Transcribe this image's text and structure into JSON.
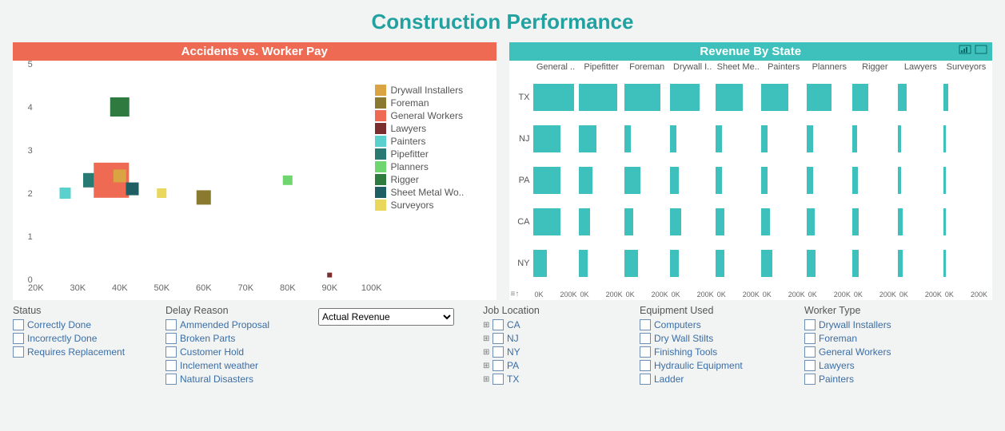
{
  "title": "Construction Performance",
  "colors": {
    "accent_red": "#ef6a53",
    "accent_teal": "#3ec1bd"
  },
  "left_panel": {
    "header": "Accidents vs. Worker Pay",
    "legend": [
      {
        "name": "Drywall Installers",
        "color": "#d9a441"
      },
      {
        "name": "Foreman",
        "color": "#8a7a2f"
      },
      {
        "name": "General Workers",
        "color": "#ef6a53"
      },
      {
        "name": "Lawyers",
        "color": "#7a2e2e"
      },
      {
        "name": "Painters",
        "color": "#5bd1cd"
      },
      {
        "name": "Pipefitter",
        "color": "#2a7a74"
      },
      {
        "name": "Planners",
        "color": "#6fd66f"
      },
      {
        "name": "Rigger",
        "color": "#2e7a3f"
      },
      {
        "name": "Sheet Metal Wo..",
        "color": "#1f5f63"
      },
      {
        "name": "Surveyors",
        "color": "#e9d85c"
      }
    ]
  },
  "right_panel": {
    "header": "Revenue By State",
    "columns": [
      "General ..",
      "Pipefitter",
      "Foreman",
      "Drywall I..",
      "Sheet Me..",
      "Painters",
      "Planners",
      "Rigger",
      "Lawyers",
      "Surveyors"
    ],
    "rows": [
      "TX",
      "NJ",
      "PA",
      "CA",
      "NY"
    ],
    "x_tick_pair": [
      "0K",
      "200K"
    ]
  },
  "filters": {
    "status": {
      "label": "Status",
      "items": [
        "Correctly Done",
        "Incorrectly Done",
        "Requires Replacement"
      ]
    },
    "delay": {
      "label": "Delay Reason",
      "items": [
        "Ammended Proposal",
        "Broken Parts",
        "Customer Hold",
        "Inclement weather",
        "Natural Disasters"
      ]
    },
    "combo_value": "Actual Revenue",
    "job_loc": {
      "label": "Job Location",
      "items": [
        "CA",
        "NJ",
        "NY",
        "PA",
        "TX"
      ]
    },
    "equip": {
      "label": "Equipment Used",
      "items": [
        "Computers",
        "Dry Wall Stilts",
        "Finishing Tools",
        "Hydraulic Equipment",
        "Ladder"
      ]
    },
    "worker": {
      "label": "Worker Type",
      "items": [
        "Drywall Installers",
        "Foreman",
        "General Workers",
        "Lawyers",
        "Painters"
      ]
    }
  },
  "chart_data": [
    {
      "type": "scatter",
      "title": "Accidents vs. Worker Pay",
      "xlabel": "",
      "ylabel": "",
      "xlim": [
        20000,
        100000
      ],
      "ylim": [
        0,
        5
      ],
      "x_ticks": [
        "20K",
        "30K",
        "40K",
        "50K",
        "60K",
        "70K",
        "80K",
        "90K",
        "100K"
      ],
      "y_ticks": [
        0,
        1,
        2,
        3,
        4,
        5
      ],
      "series": [
        {
          "name": "Painters",
          "x": 27000,
          "y": 2.0,
          "size": 14,
          "color": "#5bd1cd"
        },
        {
          "name": "Pipefitter",
          "x": 33000,
          "y": 2.3,
          "size": 18,
          "color": "#2a7a74"
        },
        {
          "name": "General Workers",
          "x": 38000,
          "y": 2.3,
          "size": 44,
          "color": "#ef6a53"
        },
        {
          "name": "Drywall Installers",
          "x": 40000,
          "y": 2.4,
          "size": 16,
          "color": "#d9a441"
        },
        {
          "name": "Sheet Metal Wo..",
          "x": 43000,
          "y": 2.1,
          "size": 16,
          "color": "#1f5f63"
        },
        {
          "name": "Rigger",
          "x": 40000,
          "y": 4.0,
          "size": 24,
          "color": "#2e7a3f"
        },
        {
          "name": "Surveyors",
          "x": 50000,
          "y": 2.0,
          "size": 12,
          "color": "#e9d85c"
        },
        {
          "name": "Foreman",
          "x": 60000,
          "y": 1.9,
          "size": 18,
          "color": "#8a7a2f"
        },
        {
          "name": "Planners",
          "x": 80000,
          "y": 2.3,
          "size": 12,
          "color": "#6fd66f"
        },
        {
          "name": "Lawyers",
          "x": 90000,
          "y": 0.1,
          "size": 6,
          "color": "#7a2e2e"
        }
      ]
    },
    {
      "type": "bar",
      "title": "Revenue By State",
      "orientation": "horizontal_small_multiples",
      "xlim": [
        0,
        200000
      ],
      "columns": [
        "General ..",
        "Pipefitter",
        "Foreman",
        "Drywall I..",
        "Sheet Me..",
        "Painters",
        "Planners",
        "Rigger",
        "Lawyers",
        "Surveyors"
      ],
      "rows": [
        "TX",
        "NJ",
        "PA",
        "CA",
        "NY"
      ],
      "values": {
        "TX": [
          180000,
          170000,
          160000,
          130000,
          120000,
          120000,
          110000,
          70000,
          40000,
          20000
        ],
        "NJ": [
          120000,
          80000,
          30000,
          30000,
          30000,
          30000,
          30000,
          20000,
          15000,
          10000
        ],
        "PA": [
          120000,
          60000,
          70000,
          40000,
          30000,
          30000,
          30000,
          25000,
          15000,
          10000
        ],
        "CA": [
          120000,
          50000,
          40000,
          50000,
          40000,
          40000,
          35000,
          30000,
          20000,
          10000
        ],
        "NY": [
          60000,
          40000,
          60000,
          40000,
          40000,
          50000,
          40000,
          30000,
          20000,
          10000
        ]
      },
      "color": "#3ec1bd"
    }
  ]
}
